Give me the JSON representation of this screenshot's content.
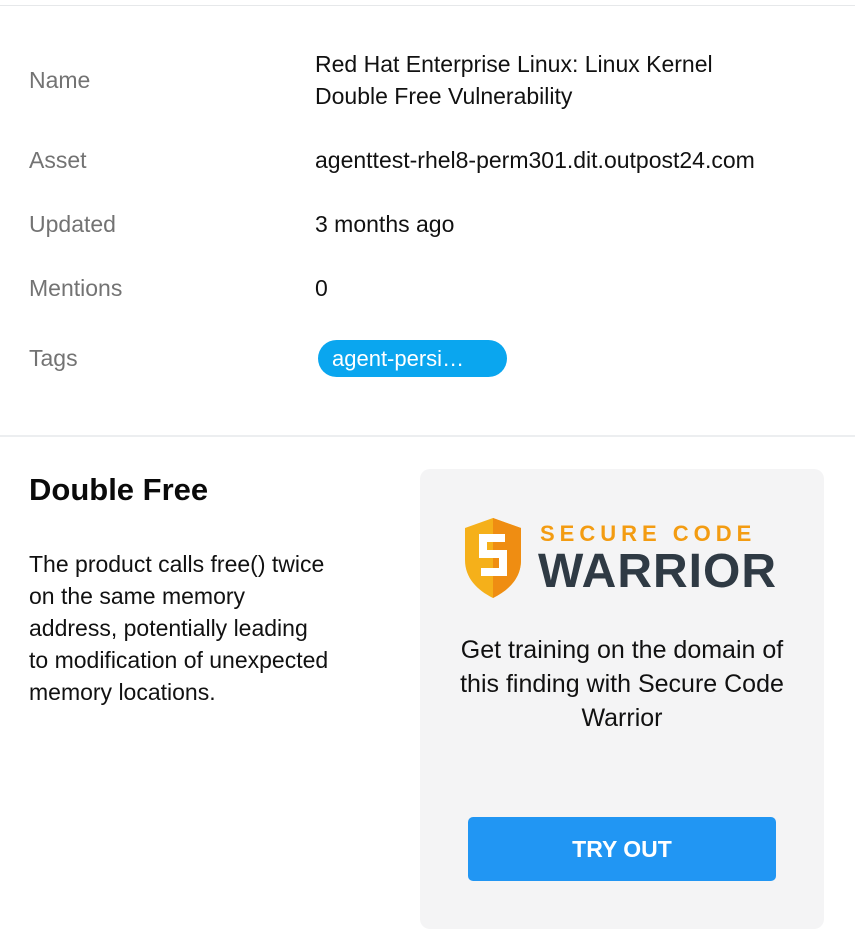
{
  "details": {
    "name_label": "Name",
    "name_value_line1": "Red Hat Enterprise Linux: Linux Kernel",
    "name_value_line2": "Double Free Vulnerability",
    "asset_label": "Asset",
    "asset_value": "agenttest-rhel8-perm301.dit.outpost24.com",
    "updated_label": "Updated",
    "updated_value": "3 months ago",
    "mentions_label": "Mentions",
    "mentions_value": "0",
    "tags_label": "Tags",
    "tags": [
      "agent-persi…"
    ]
  },
  "cwe": {
    "title": "Double Free",
    "description": "The product calls free() twice on the same memory address, potentially leading to modification of unexpected memory locations."
  },
  "training": {
    "logo_secure": "SECURE CODE",
    "logo_warrior": "WARRIOR",
    "text": "Get training on the domain of this finding with Secure Code Warrior",
    "button_label": "TRY OUT"
  },
  "colors": {
    "tag_bg": "#0aa6ef",
    "button_bg": "#2196f3",
    "logo_orange": "#f39c12",
    "logo_dark": "#2f3a44",
    "card_bg": "#f4f4f5"
  }
}
